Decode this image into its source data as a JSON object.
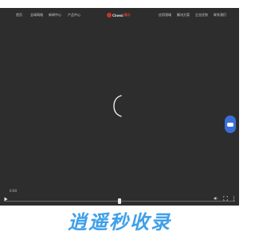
{
  "nav": {
    "left_items": [
      "首页",
      "全球网络",
      "新闻中心",
      "产品中心"
    ],
    "right_items": [
      "应用领域",
      "解决方案",
      "企业优势",
      "联系我们"
    ],
    "logo_text": "Cinesi",
    "logo_accent": "展示"
  },
  "player": {
    "time_label": "0:00",
    "progress": 0.5
  },
  "banner": {
    "text": "逍遥秒收录"
  },
  "icons": {
    "top": [
      "phone-icon",
      "search-icon",
      "menu-icon"
    ],
    "controls": [
      "play-icon",
      "volume-icon",
      "fullscreen-icon",
      "more-icon"
    ]
  },
  "colors": {
    "player_bg": "#2d2d2d",
    "float_button": "#3b6fd8",
    "banner_text": "#3fa0ea",
    "logo_accent": "#d73a2b"
  }
}
